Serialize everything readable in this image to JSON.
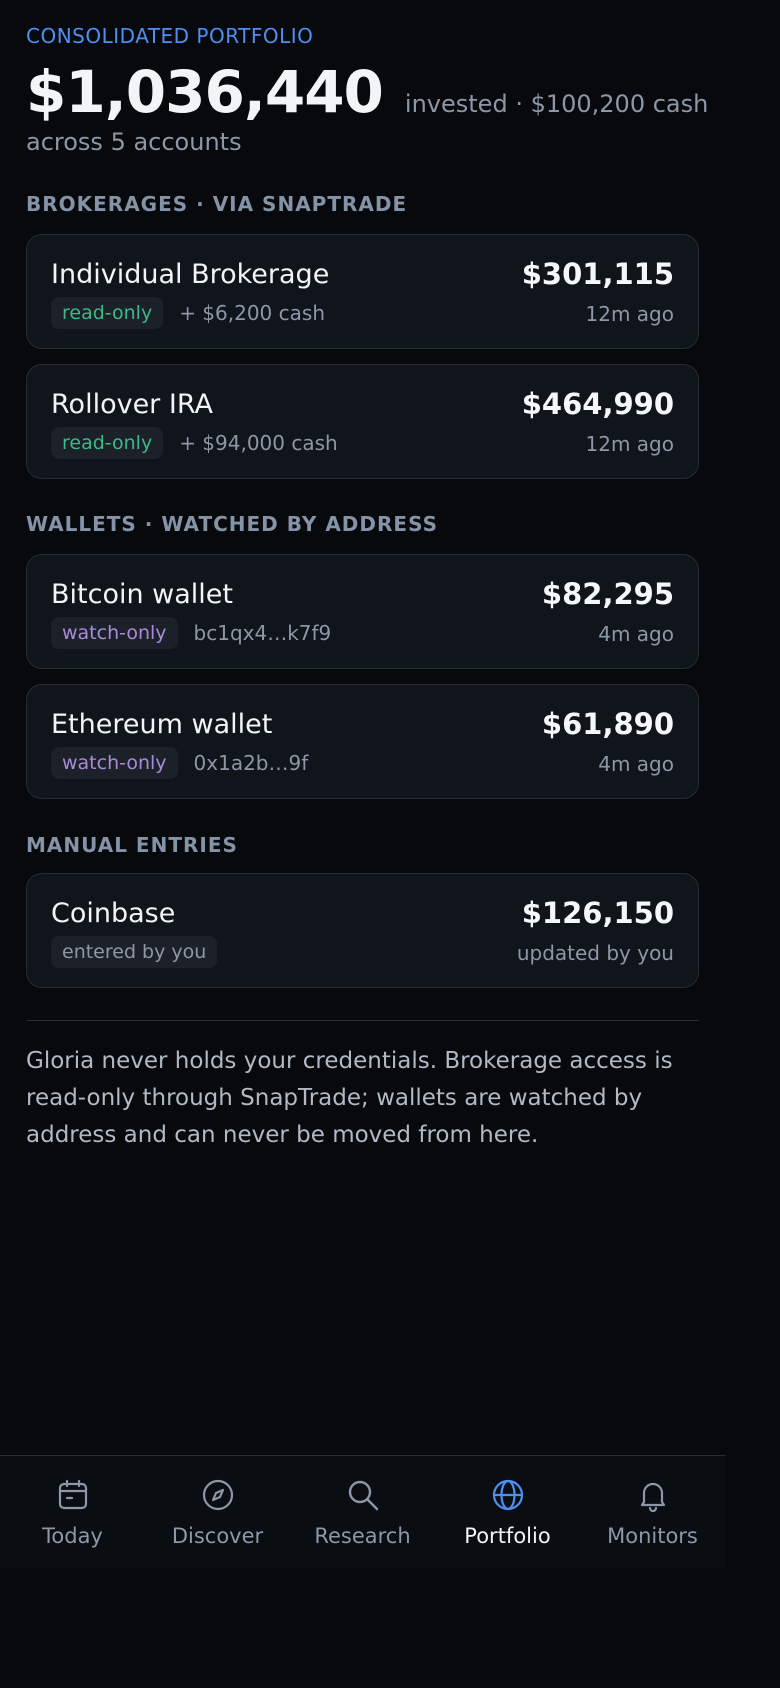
{
  "header": {
    "eyebrow": "CONSOLIDATED PORTFOLIO",
    "total": "$1,036,440",
    "subtitle": "invested · $100,200 cash",
    "accounts": "across 5 accounts"
  },
  "sections": {
    "brokerages": "BROKERAGES · VIA SNAPTRADE",
    "wallets": "WALLETS · WATCHED BY ADDRESS",
    "manual": "MANUAL ENTRIES"
  },
  "accounts": [
    {
      "name": "Individual Brokerage",
      "value": "$301,115",
      "badge": "read-only",
      "meta": "+ $6,200 cash",
      "time": "12m ago"
    },
    {
      "name": "Rollover IRA",
      "value": "$464,990",
      "badge": "read-only",
      "meta": "+ $94,000 cash",
      "time": "12m ago"
    },
    {
      "name": "Bitcoin wallet",
      "value": "$82,295",
      "badge": "watch-only",
      "meta": "bc1qx4…k7f9",
      "time": "4m ago"
    },
    {
      "name": "Ethereum wallet",
      "value": "$61,890",
      "badge": "watch-only",
      "meta": "0x1a2b…9f",
      "time": "4m ago"
    },
    {
      "name": "Coinbase",
      "value": "$126,150",
      "badge": "entered by you",
      "meta": "",
      "time": "updated by you"
    }
  ],
  "footnote": "Gloria never holds your credentials. Brokerage access is read-only through SnapTrade; wallets are watched by address and can never be moved from here.",
  "tabs": [
    {
      "label": "Today",
      "icon": "calendar-icon"
    },
    {
      "label": "Discover",
      "icon": "compass-icon"
    },
    {
      "label": "Research",
      "icon": "search-icon"
    },
    {
      "label": "Portfolio",
      "icon": "globe-icon",
      "active": true
    },
    {
      "label": "Monitors",
      "icon": "bell-icon"
    }
  ],
  "colors": {
    "accent": "#4f8ff0",
    "readonly": "#3eb984",
    "watchonly": "#a98bd9",
    "background": "#07090d"
  }
}
